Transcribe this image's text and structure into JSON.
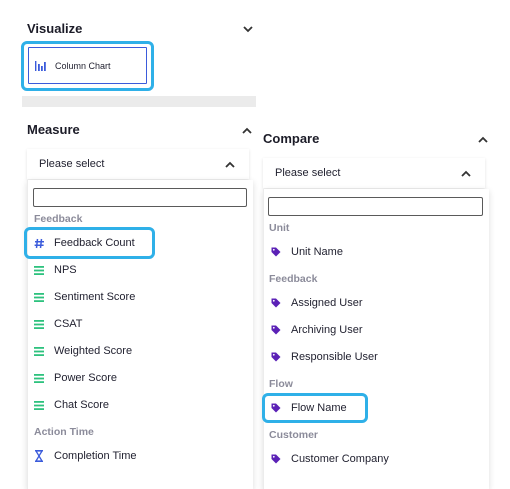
{
  "visualize": {
    "title": "Visualize",
    "chart_label": "Column Chart",
    "chart_icon": "column-chart-icon"
  },
  "measure": {
    "title": "Measure",
    "select_label": "Please select",
    "search_value": "",
    "groups": [
      {
        "label": "Feedback",
        "items": [
          {
            "label": "Feedback Count",
            "icon": "hash-icon",
            "highlighted": true
          },
          {
            "label": "NPS",
            "icon": "lines-icon"
          },
          {
            "label": "Sentiment Score",
            "icon": "lines-icon"
          },
          {
            "label": "CSAT",
            "icon": "lines-icon"
          },
          {
            "label": "Weighted Score",
            "icon": "lines-icon"
          },
          {
            "label": "Power Score",
            "icon": "lines-icon"
          },
          {
            "label": "Chat Score",
            "icon": "lines-icon"
          }
        ]
      },
      {
        "label": "Action Time",
        "items": [
          {
            "label": "Completion Time",
            "icon": "hourglass-icon"
          }
        ]
      }
    ]
  },
  "compare": {
    "title": "Compare",
    "select_label": "Please select",
    "search_value": "",
    "groups": [
      {
        "label": "Unit",
        "items": [
          {
            "label": "Unit Name",
            "icon": "tag-icon"
          }
        ]
      },
      {
        "label": "Feedback",
        "items": [
          {
            "label": "Assigned User",
            "icon": "tag-icon"
          },
          {
            "label": "Archiving User",
            "icon": "tag-icon"
          },
          {
            "label": "Responsible User",
            "icon": "tag-icon"
          }
        ]
      },
      {
        "label": "Flow",
        "items": [
          {
            "label": "Flow Name",
            "icon": "tag-icon",
            "highlighted": true
          }
        ]
      },
      {
        "label": "Customer",
        "items": [
          {
            "label": "Customer Company",
            "icon": "tag-icon"
          }
        ]
      }
    ]
  },
  "colors": {
    "accent_blue": "#3b5bdb",
    "highlight_ring": "#2fb0e8",
    "green_lines": "#2ec27e",
    "tag_purple": "#5b21b6"
  }
}
